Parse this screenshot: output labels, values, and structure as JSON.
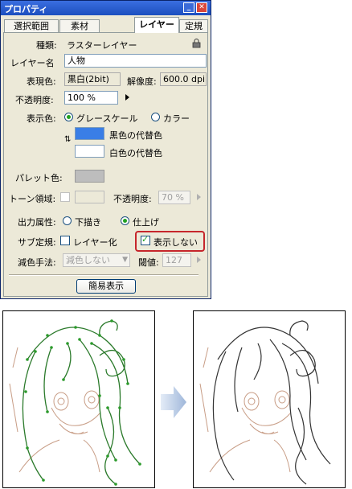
{
  "window": {
    "title": "プロパティ"
  },
  "tabs": [
    "選択範囲",
    "素材",
    "レイヤー",
    "定規"
  ],
  "layer": {
    "type_label": "種類:",
    "type_value": "ラスターレイヤー",
    "name_label": "レイヤー名",
    "name_value": "人物",
    "expression_label": "表現色:",
    "expression_value": "黒白(2bit)",
    "resolution_label": "解像度:",
    "resolution_value": "600.0 dpi",
    "opacity_label": "不透明度:",
    "opacity_value": "100 %",
    "display_color_label": "表示色:",
    "display_options": [
      "グレースケール",
      "カラー"
    ],
    "black_sub_label": "黒色の代替色",
    "white_sub_label": "白色の代替色",
    "palette_label": "パレット色:",
    "tone_area_label": "トーン領域:",
    "tone_opacity_label": "不透明度:",
    "tone_opacity_value": "70 %",
    "output_label": "出力属性:",
    "output_options": [
      "下描き",
      "仕上げ"
    ],
    "sub_ruler_label": "サブ定規:",
    "sub_ruler_layerize": "レイヤー化",
    "sub_ruler_hide": "表示しない",
    "reduce_method_label": "減色手法:",
    "reduce_method_value": "減色しない",
    "threshold_label": "閾値:",
    "threshold_value": "127",
    "simple_view_button": "簡易表示"
  },
  "colors": {
    "black_substitute": "#3a7ee6",
    "white_substitute": "#ffffff",
    "palette": "#bdbdbd",
    "highlight": "#c6262b"
  },
  "illustrations": {
    "arrow_icon": "right-arrow"
  }
}
